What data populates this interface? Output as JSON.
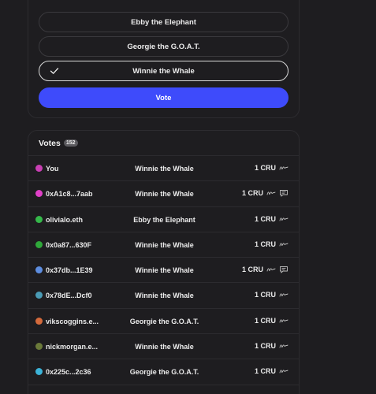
{
  "proposal": {
    "choices": [
      {
        "label": "Ebby the Elephant",
        "selected": false
      },
      {
        "label": "Georgie the G.O.A.T.",
        "selected": false
      },
      {
        "label": "Winnie the Whale",
        "selected": true
      }
    ],
    "vote_label": "Vote",
    "accent": "#3e4bfb"
  },
  "votes": {
    "title": "Votes",
    "count": "152",
    "rows": [
      {
        "voter": "You",
        "choice": "Winnie the Whale",
        "power": "1 CRU",
        "avatar_color": "#c93fb4",
        "has_comment": false
      },
      {
        "voter": "0xA1c8...7aab",
        "choice": "Winnie the Whale",
        "power": "1 CRU",
        "avatar_color": "#e040c8",
        "has_comment": true
      },
      {
        "voter": "olivialo.eth",
        "choice": "Ebby the Elephant",
        "power": "1 CRU",
        "avatar_color": "#35b84a",
        "has_comment": false
      },
      {
        "voter": "0x0a87...630F",
        "choice": "Winnie the Whale",
        "power": "1 CRU",
        "avatar_color": "#2fa83a",
        "has_comment": false
      },
      {
        "voter": "0x37db...1E39",
        "choice": "Winnie the Whale",
        "power": "1 CRU",
        "avatar_color": "#5d8de0",
        "has_comment": true
      },
      {
        "voter": "0x78dE...Dcf0",
        "choice": "Winnie the Whale",
        "power": "1 CRU",
        "avatar_color": "#4a9bb5",
        "has_comment": false
      },
      {
        "voter": "vikscoggins.e...",
        "choice": "Georgie the G.O.A.T.",
        "power": "1 CRU",
        "avatar_color": "#d46a3c",
        "has_comment": false
      },
      {
        "voter": "nickmorgan.e...",
        "choice": "Winnie the Whale",
        "power": "1 CRU",
        "avatar_color": "#6b7a3a",
        "has_comment": false
      },
      {
        "voter": "0x225c...2c36",
        "choice": "Georgie the G.O.A.T.",
        "power": "1 CRU",
        "avatar_color": "#3cb3d8",
        "has_comment": false
      }
    ]
  }
}
